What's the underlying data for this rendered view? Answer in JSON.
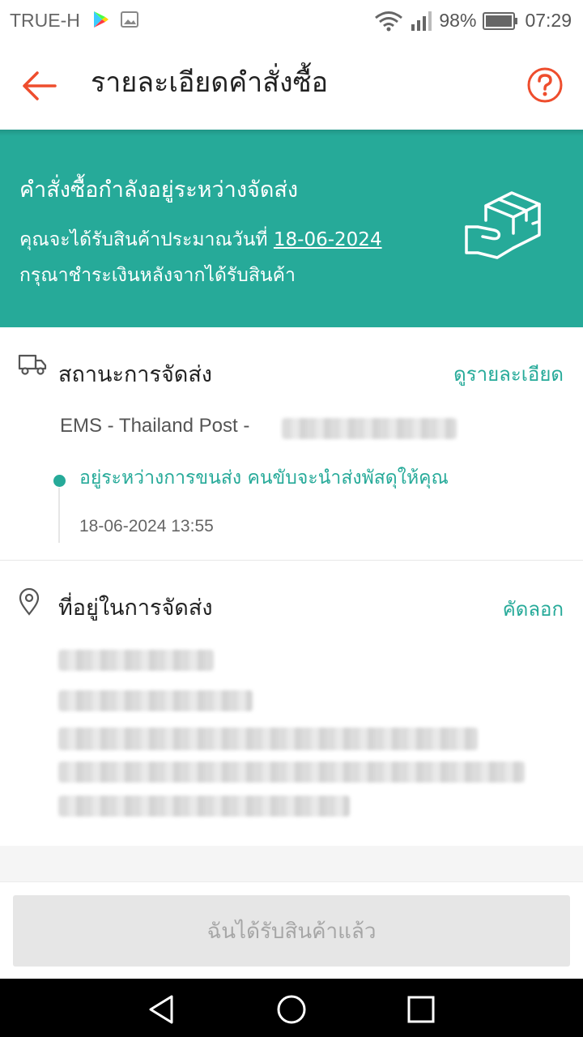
{
  "status_bar": {
    "carrier": "TRUE-H",
    "battery": "98%",
    "time": "07:29"
  },
  "app_bar": {
    "title": "รายละเอียดคำสั่งซื้อ",
    "back_icon": "arrow-left-icon",
    "help_icon": "question-circle-icon",
    "accent_color": "#ee4d2d"
  },
  "banner": {
    "headline": "คำสั่งซื้อกำลังอยู่ระหว่างจัดส่ง",
    "eta_prefix": "คุณจะได้รับสินค้าประมาณวันที่ ",
    "eta_date": "18-06-2024",
    "payment_note": "กรุณาชำระเงินหลังจากได้รับสินค้า",
    "background_color": "#26aa99"
  },
  "shipping": {
    "heading": "สถานะการจัดส่ง",
    "details_link": "ดูรายละเอียด",
    "carrier_label": "EMS - Thailand Post - ",
    "latest_event": "อยู่ระหว่างการขนส่ง คนขับจะนำส่งพัสดุให้คุณ",
    "latest_event_time": "18-06-2024 13:55"
  },
  "address": {
    "heading": "ที่อยู่ในการจัดส่ง",
    "copy_link": "คัดลอก"
  },
  "bottom": {
    "confirm_button": "ฉันได้รับสินค้าแล้ว"
  }
}
